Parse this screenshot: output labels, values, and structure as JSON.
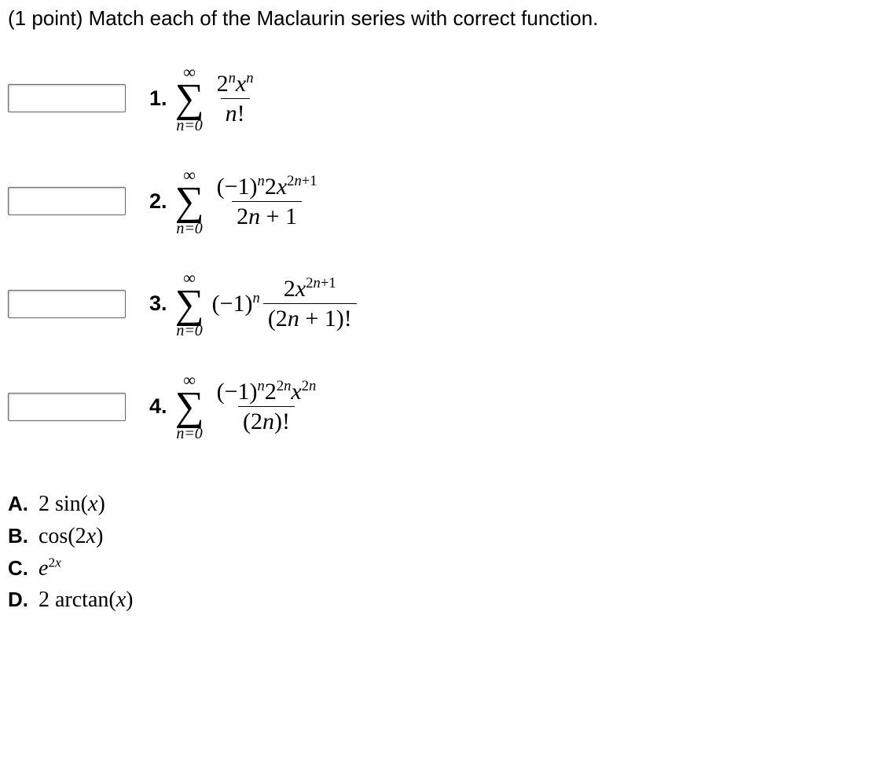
{
  "instruction": "(1 point) Match each of the Maclaurin series with correct function.",
  "sigma": {
    "top": "∞",
    "bottom": "n=0",
    "symbol": "∑"
  },
  "items": [
    {
      "label": "1.",
      "pre": "",
      "num": "2nxn",
      "num_html": "2<span class='sup'>n</span><span class='it'>x</span><span class='sup'>n</span>",
      "den": "n!",
      "den_html": "<span class='it'>n</span>!"
    },
    {
      "label": "2.",
      "pre": "",
      "num_html": "(−1)<span class='sup'>n</span>2<span class='it'>x</span><span class='sup supn'>2<span class='it'>n</span>+1</span>",
      "den_html": "2<span class='it'>n</span> + 1"
    },
    {
      "label": "3.",
      "pre_html": "(−1)<span class='sup'>n</span>",
      "num_html": "2<span class='it'>x</span><span class='sup supn'>2<span class='it'>n</span>+1</span>",
      "den_html": "(2<span class='it'>n</span> + 1)!"
    },
    {
      "label": "4.",
      "pre": "",
      "num_html": "(−1)<span class='sup'>n</span>2<span class='sup supn'>2<span class='it'>n</span></span><span class='it'>x</span><span class='sup supn'>2<span class='it'>n</span></span>",
      "den_html": "(2<span class='it'>n</span>)!"
    }
  ],
  "options": [
    {
      "label": "A.",
      "value_html": "2 sin(<span class='it'>x</span>)"
    },
    {
      "label": "B.",
      "value_html": "cos(2<span class='it'>x</span>)"
    },
    {
      "label": "C.",
      "value_html": "<span class='it'>e</span><span class='sup supn'>2<span class='it'>x</span></span>"
    },
    {
      "label": "D.",
      "value_html": "2 arctan(<span class='it'>x</span>)"
    }
  ]
}
